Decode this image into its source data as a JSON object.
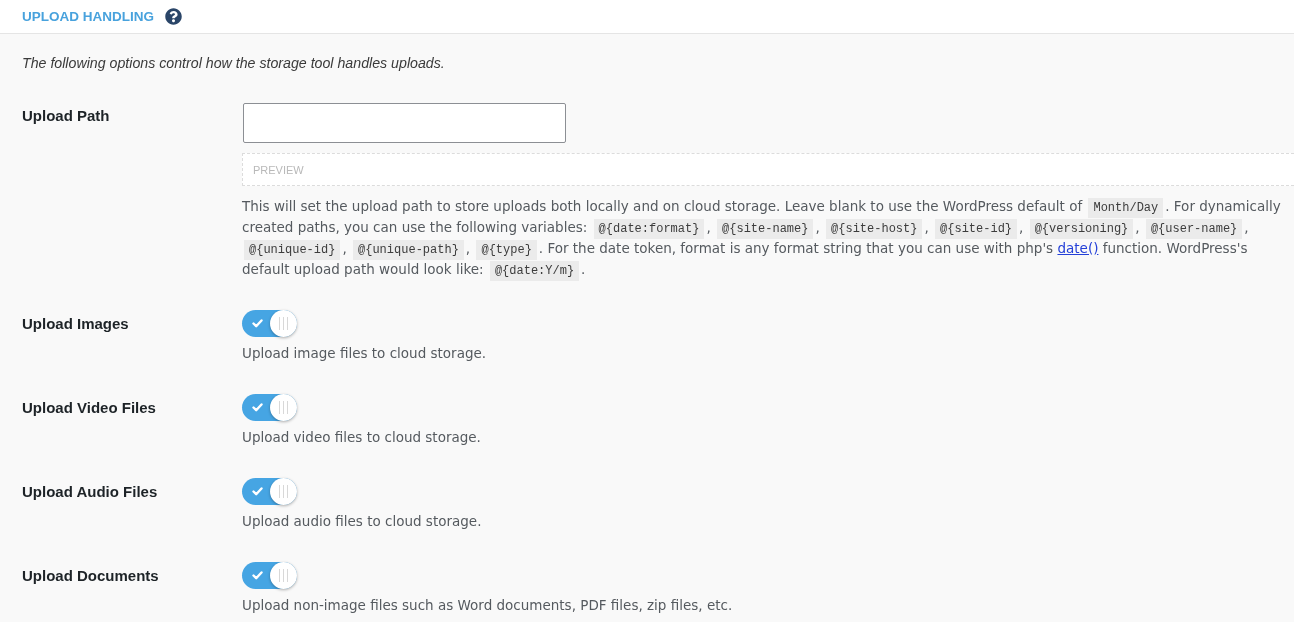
{
  "section": {
    "title": "UPLOAD HANDLING",
    "intro": "The following options control how the storage tool handles uploads."
  },
  "upload_path": {
    "label": "Upload Path",
    "preview": "PREVIEW",
    "description": [
      {
        "kind": "text",
        "text": "This will set the upload path to store uploads both locally and on cloud storage. Leave blank to use the WordPress default of "
      },
      {
        "kind": "code",
        "text": "Month/Day"
      },
      {
        "kind": "text",
        "text": ". For dynamically created paths, you can use the following variables: "
      },
      {
        "kind": "code",
        "text": "@{date:format}"
      },
      {
        "kind": "text",
        "text": ", "
      },
      {
        "kind": "code",
        "text": "@{site-name}"
      },
      {
        "kind": "text",
        "text": ", "
      },
      {
        "kind": "code",
        "text": "@{site-host}"
      },
      {
        "kind": "text",
        "text": ", "
      },
      {
        "kind": "code",
        "text": "@{site-id}"
      },
      {
        "kind": "text",
        "text": ", "
      },
      {
        "kind": "code",
        "text": "@{versioning}"
      },
      {
        "kind": "text",
        "text": ", "
      },
      {
        "kind": "code",
        "text": "@{user-name}"
      },
      {
        "kind": "text",
        "text": ", "
      },
      {
        "kind": "code",
        "text": "@{unique-id}"
      },
      {
        "kind": "text",
        "text": ", "
      },
      {
        "kind": "code",
        "text": "@{unique-path}"
      },
      {
        "kind": "text",
        "text": ", "
      },
      {
        "kind": "code",
        "text": "@{type}"
      },
      {
        "kind": "text",
        "text": ". For the date token, format is any format string that you can use with php's "
      },
      {
        "kind": "link",
        "text": "date()"
      },
      {
        "kind": "text",
        "text": " function. WordPress's default upload path would look like: "
      },
      {
        "kind": "code",
        "text": "@{date:Y/m}"
      },
      {
        "kind": "text",
        "text": "."
      }
    ]
  },
  "toggles": [
    {
      "label": "Upload Images",
      "on": true,
      "description": "Upload image files to cloud storage."
    },
    {
      "label": "Upload Video Files",
      "on": true,
      "description": "Upload video files to cloud storage."
    },
    {
      "label": "Upload Audio Files",
      "on": true,
      "description": "Upload audio files to cloud storage."
    },
    {
      "label": "Upload Documents",
      "on": true,
      "description": "Upload non-image files such as Word documents, PDF files, zip files, etc."
    }
  ]
}
